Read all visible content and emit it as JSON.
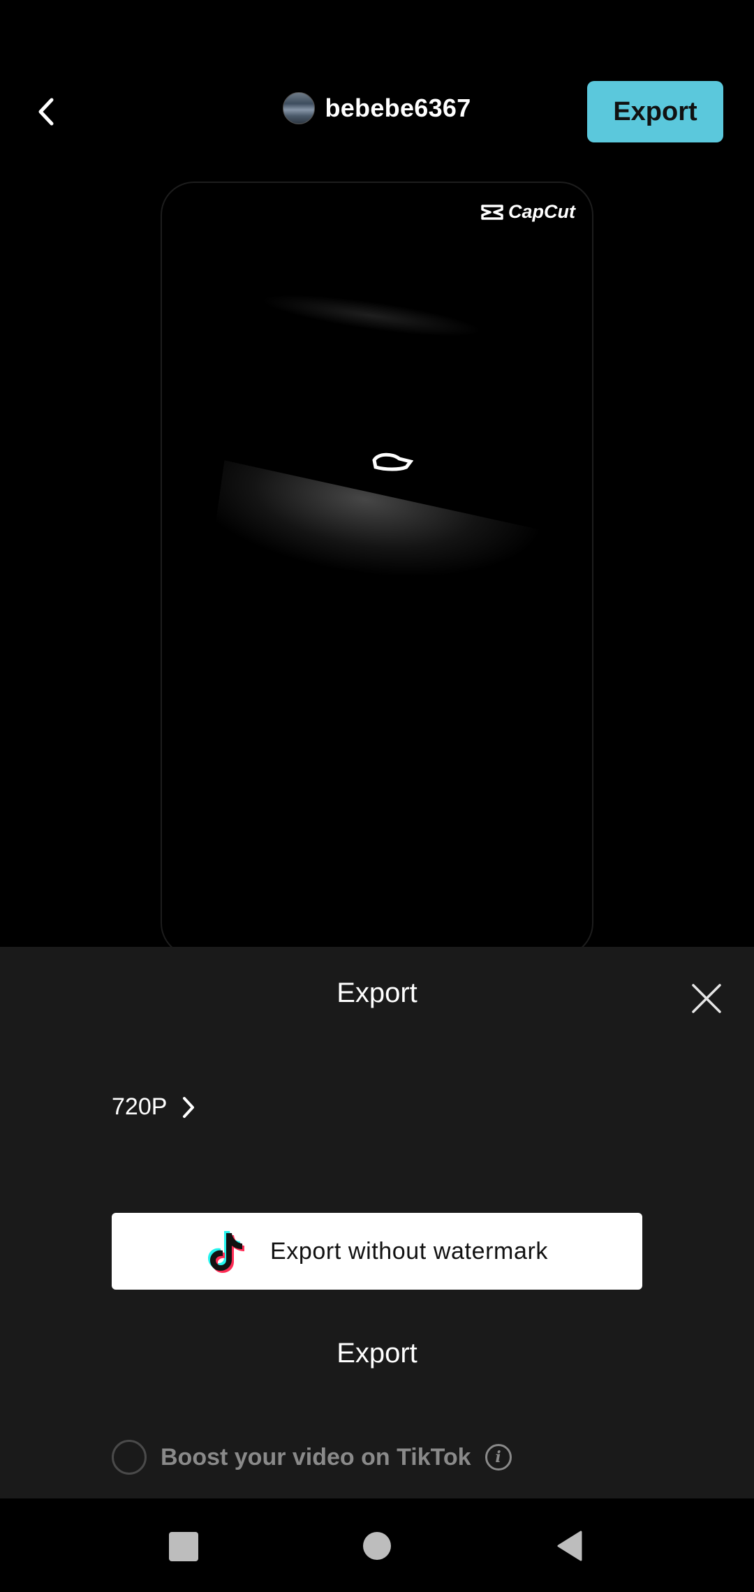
{
  "header": {
    "username": "bebebe6367",
    "export_button": "Export"
  },
  "preview": {
    "watermark": "CapCut"
  },
  "sheet": {
    "title": "Export",
    "resolution": "720P",
    "tiktok_button": "Export without watermark",
    "export_label": "Export",
    "boost_label": "Boost your video on TikTok",
    "info_glyph": "i"
  },
  "colors": {
    "accent": "#5bc8dc",
    "sheet_bg": "#1a1a1a",
    "tiktok_cyan": "#25f4ee",
    "tiktok_red": "#fe2c55"
  },
  "icons": {
    "back": "chevron-left-icon",
    "close": "close-icon",
    "resolution_chevron": "chevron-right-icon",
    "tiktok": "tiktok-logo-icon",
    "info": "info-icon",
    "nav_recents": "square-icon",
    "nav_home": "circle-icon",
    "nav_back": "triangle-back-icon"
  }
}
